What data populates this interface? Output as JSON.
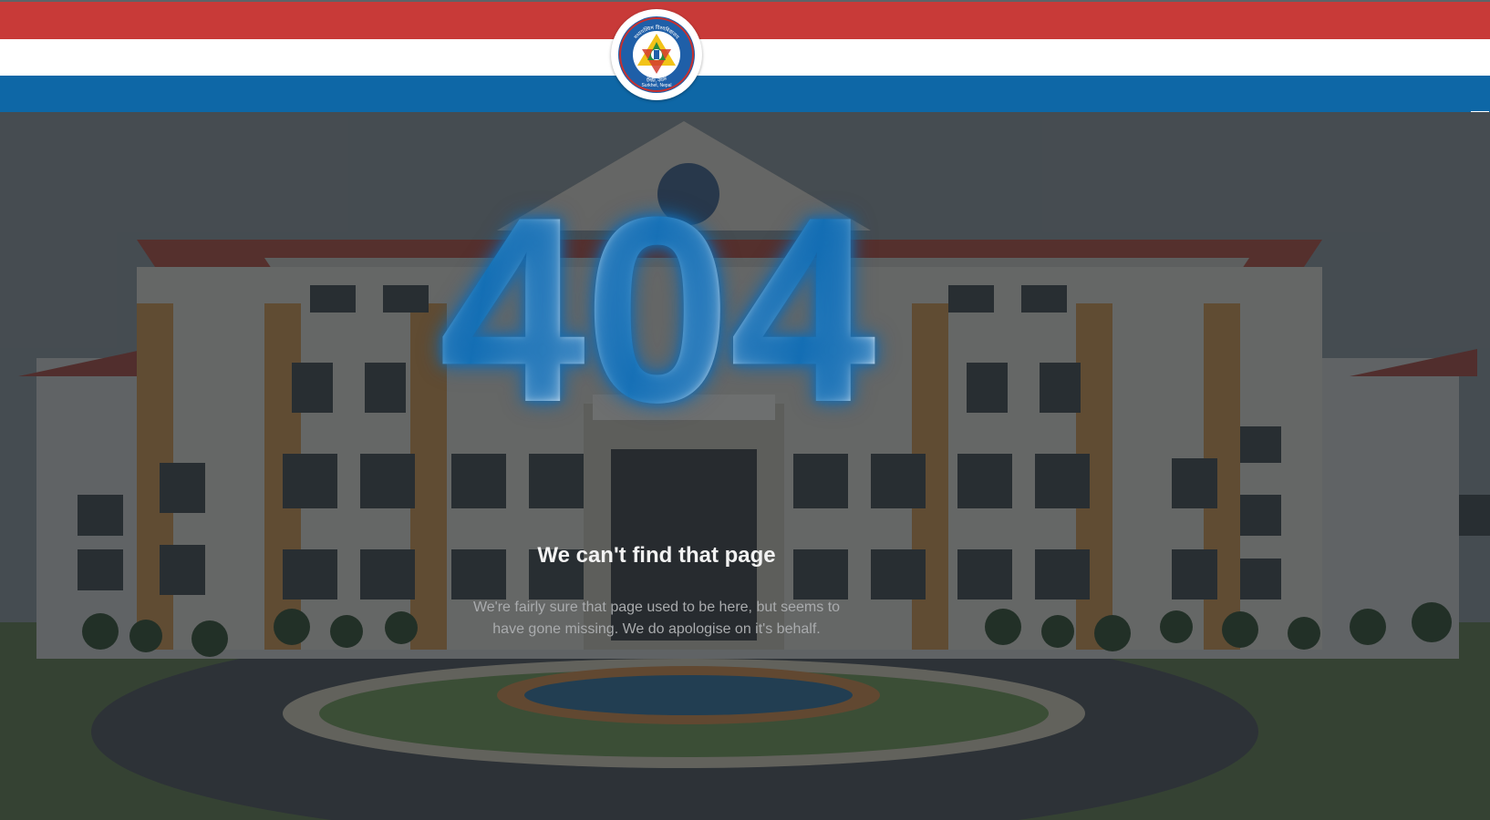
{
  "colors": {
    "stripe_red": "#c83a38",
    "stripe_white": "#ffffff",
    "stripe_blue": "#0e67a6",
    "accent_blue": "#1a78b8",
    "overlay": "#1c2025"
  },
  "header": {
    "logo": {
      "icon": "university-seal-icon",
      "text_top": "मध्यपश्चिम विश्वविद्यालय",
      "text_mid": "Mid-West University",
      "text_bottom_np": "सुर्खेत, नेपाल",
      "text_bottom": "Surkhet, Nepal"
    }
  },
  "error": {
    "code": "404",
    "title": "We can't find that page",
    "message": "We're fairly sure that page used to be here, but seems to have gone missing. We do apologise on it's behalf."
  }
}
